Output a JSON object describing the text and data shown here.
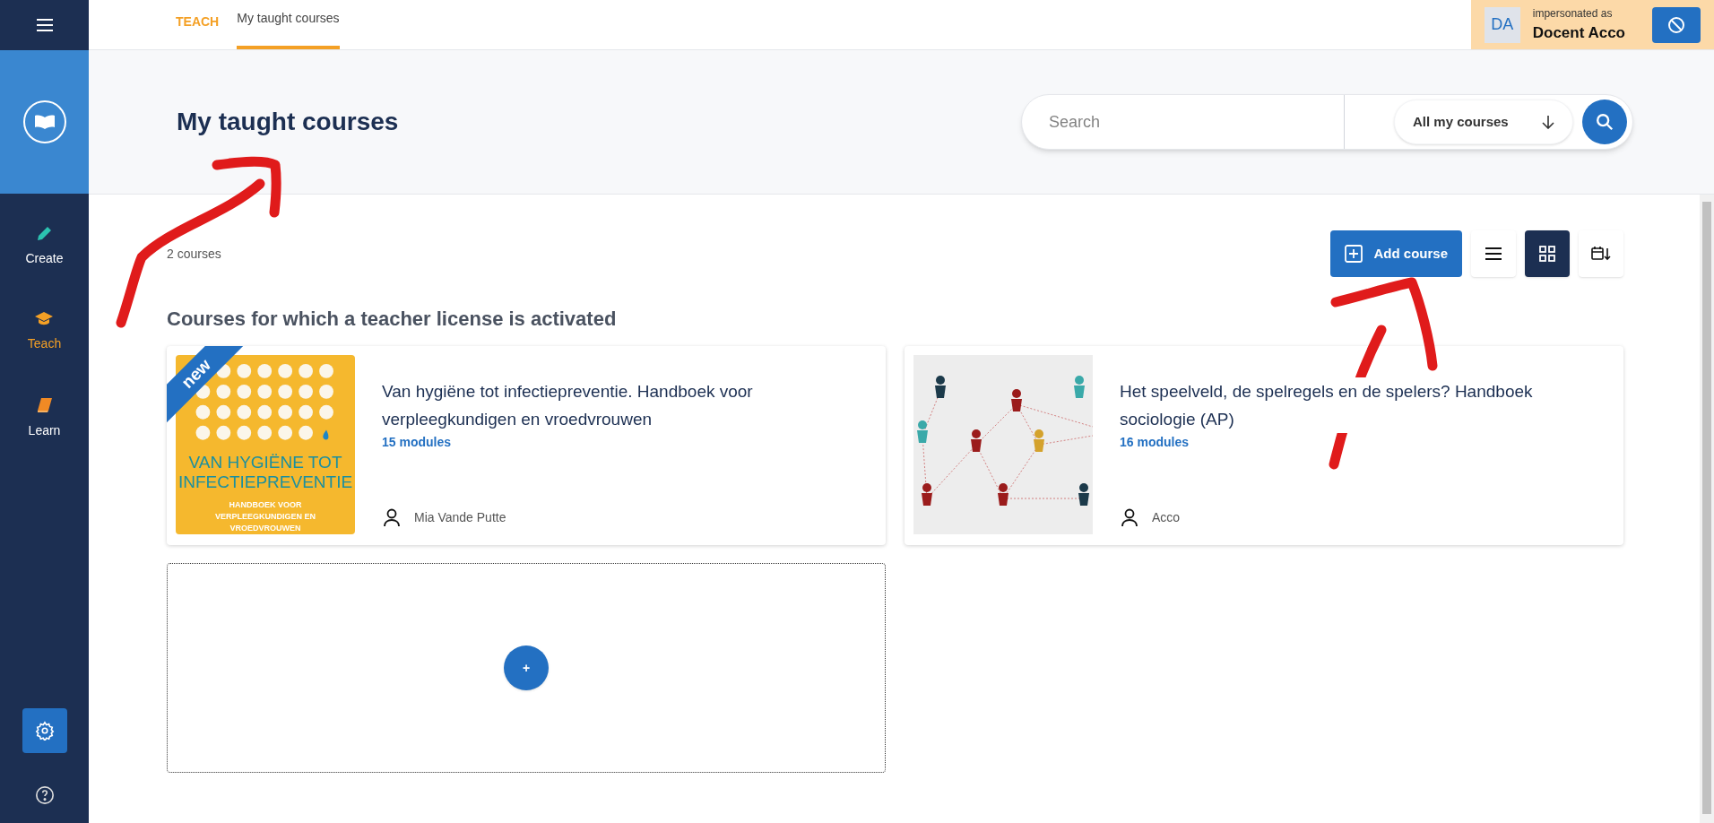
{
  "top_nav": {
    "section": "TEACH",
    "tabs": [
      {
        "label": "My taught courses",
        "selected": true
      }
    ]
  },
  "impersonation": {
    "initials": "DA",
    "caption": "impersonated as",
    "name": "Docent Acco"
  },
  "sidebar": {
    "items": [
      {
        "kind": "pencil",
        "label": "Create",
        "selected": false
      },
      {
        "kind": "cap",
        "label": "Teach",
        "selected": true
      },
      {
        "kind": "book",
        "label": "Learn",
        "selected": false
      }
    ]
  },
  "header": {
    "title": "My taught courses",
    "search": {
      "placeholder": "Search"
    },
    "filter": "All my courses"
  },
  "toolbar": {
    "add_label": "Add course",
    "views": [
      {
        "kind": "list",
        "selected": false
      },
      {
        "kind": "grid",
        "selected": true
      },
      {
        "kind": "calendar",
        "selected": false
      }
    ]
  },
  "count": "2 courses",
  "section_title": "Courses for which a teacher license is activated",
  "courses": [
    {
      "kind": "book-cover",
      "badge": "new",
      "cover_title": "VAN HYGIËNE TOT INFECTIEPREVENTIE",
      "cover_subtitle": "HANDBOEK VOOR VERPLEEGKUNDIGEN EN VROEDVROUWEN",
      "title": "Van hygiëne tot infectiepreventie. Handboek voor verpleegkundigen en vroedvrouwen",
      "modules": "15 modules",
      "author": "Mia Vande Putte"
    },
    {
      "kind": "network",
      "title": "Het speelveld, de spelregels en de spelers? Handboek sociologie (AP)",
      "modules": "16 modules",
      "author": "Acco"
    }
  ],
  "add_tile": {
    "label": "+"
  }
}
